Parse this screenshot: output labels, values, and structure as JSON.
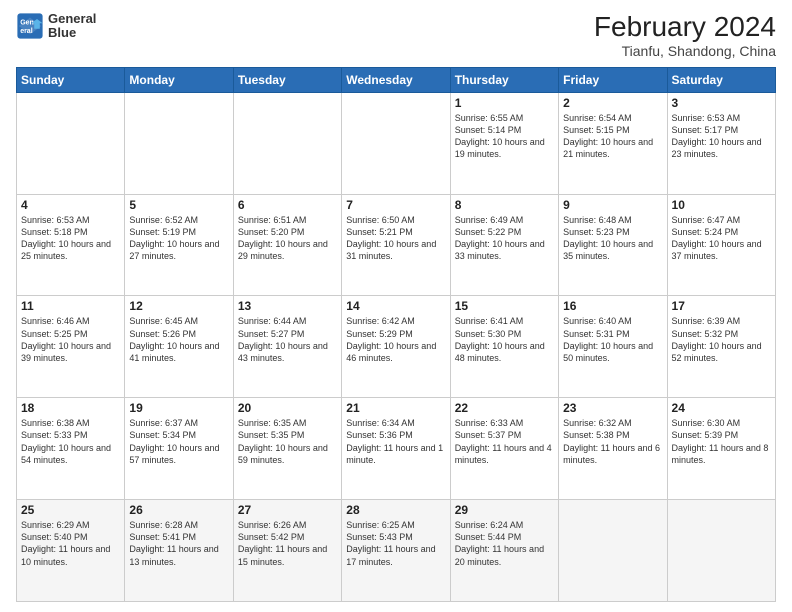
{
  "logo": {
    "line1": "General",
    "line2": "Blue"
  },
  "title": "February 2024",
  "subtitle": "Tianfu, Shandong, China",
  "weekdays": [
    "Sunday",
    "Monday",
    "Tuesday",
    "Wednesday",
    "Thursday",
    "Friday",
    "Saturday"
  ],
  "weeks": [
    [
      {
        "day": "",
        "info": ""
      },
      {
        "day": "",
        "info": ""
      },
      {
        "day": "",
        "info": ""
      },
      {
        "day": "",
        "info": ""
      },
      {
        "day": "1",
        "info": "Sunrise: 6:55 AM\nSunset: 5:14 PM\nDaylight: 10 hours and 19 minutes."
      },
      {
        "day": "2",
        "info": "Sunrise: 6:54 AM\nSunset: 5:15 PM\nDaylight: 10 hours and 21 minutes."
      },
      {
        "day": "3",
        "info": "Sunrise: 6:53 AM\nSunset: 5:17 PM\nDaylight: 10 hours and 23 minutes."
      }
    ],
    [
      {
        "day": "4",
        "info": "Sunrise: 6:53 AM\nSunset: 5:18 PM\nDaylight: 10 hours and 25 minutes."
      },
      {
        "day": "5",
        "info": "Sunrise: 6:52 AM\nSunset: 5:19 PM\nDaylight: 10 hours and 27 minutes."
      },
      {
        "day": "6",
        "info": "Sunrise: 6:51 AM\nSunset: 5:20 PM\nDaylight: 10 hours and 29 minutes."
      },
      {
        "day": "7",
        "info": "Sunrise: 6:50 AM\nSunset: 5:21 PM\nDaylight: 10 hours and 31 minutes."
      },
      {
        "day": "8",
        "info": "Sunrise: 6:49 AM\nSunset: 5:22 PM\nDaylight: 10 hours and 33 minutes."
      },
      {
        "day": "9",
        "info": "Sunrise: 6:48 AM\nSunset: 5:23 PM\nDaylight: 10 hours and 35 minutes."
      },
      {
        "day": "10",
        "info": "Sunrise: 6:47 AM\nSunset: 5:24 PM\nDaylight: 10 hours and 37 minutes."
      }
    ],
    [
      {
        "day": "11",
        "info": "Sunrise: 6:46 AM\nSunset: 5:25 PM\nDaylight: 10 hours and 39 minutes."
      },
      {
        "day": "12",
        "info": "Sunrise: 6:45 AM\nSunset: 5:26 PM\nDaylight: 10 hours and 41 minutes."
      },
      {
        "day": "13",
        "info": "Sunrise: 6:44 AM\nSunset: 5:27 PM\nDaylight: 10 hours and 43 minutes."
      },
      {
        "day": "14",
        "info": "Sunrise: 6:42 AM\nSunset: 5:29 PM\nDaylight: 10 hours and 46 minutes."
      },
      {
        "day": "15",
        "info": "Sunrise: 6:41 AM\nSunset: 5:30 PM\nDaylight: 10 hours and 48 minutes."
      },
      {
        "day": "16",
        "info": "Sunrise: 6:40 AM\nSunset: 5:31 PM\nDaylight: 10 hours and 50 minutes."
      },
      {
        "day": "17",
        "info": "Sunrise: 6:39 AM\nSunset: 5:32 PM\nDaylight: 10 hours and 52 minutes."
      }
    ],
    [
      {
        "day": "18",
        "info": "Sunrise: 6:38 AM\nSunset: 5:33 PM\nDaylight: 10 hours and 54 minutes."
      },
      {
        "day": "19",
        "info": "Sunrise: 6:37 AM\nSunset: 5:34 PM\nDaylight: 10 hours and 57 minutes."
      },
      {
        "day": "20",
        "info": "Sunrise: 6:35 AM\nSunset: 5:35 PM\nDaylight: 10 hours and 59 minutes."
      },
      {
        "day": "21",
        "info": "Sunrise: 6:34 AM\nSunset: 5:36 PM\nDaylight: 11 hours and 1 minute."
      },
      {
        "day": "22",
        "info": "Sunrise: 6:33 AM\nSunset: 5:37 PM\nDaylight: 11 hours and 4 minutes."
      },
      {
        "day": "23",
        "info": "Sunrise: 6:32 AM\nSunset: 5:38 PM\nDaylight: 11 hours and 6 minutes."
      },
      {
        "day": "24",
        "info": "Sunrise: 6:30 AM\nSunset: 5:39 PM\nDaylight: 11 hours and 8 minutes."
      }
    ],
    [
      {
        "day": "25",
        "info": "Sunrise: 6:29 AM\nSunset: 5:40 PM\nDaylight: 11 hours and 10 minutes."
      },
      {
        "day": "26",
        "info": "Sunrise: 6:28 AM\nSunset: 5:41 PM\nDaylight: 11 hours and 13 minutes."
      },
      {
        "day": "27",
        "info": "Sunrise: 6:26 AM\nSunset: 5:42 PM\nDaylight: 11 hours and 15 minutes."
      },
      {
        "day": "28",
        "info": "Sunrise: 6:25 AM\nSunset: 5:43 PM\nDaylight: 11 hours and 17 minutes."
      },
      {
        "day": "29",
        "info": "Sunrise: 6:24 AM\nSunset: 5:44 PM\nDaylight: 11 hours and 20 minutes."
      },
      {
        "day": "",
        "info": ""
      },
      {
        "day": "",
        "info": ""
      }
    ]
  ]
}
